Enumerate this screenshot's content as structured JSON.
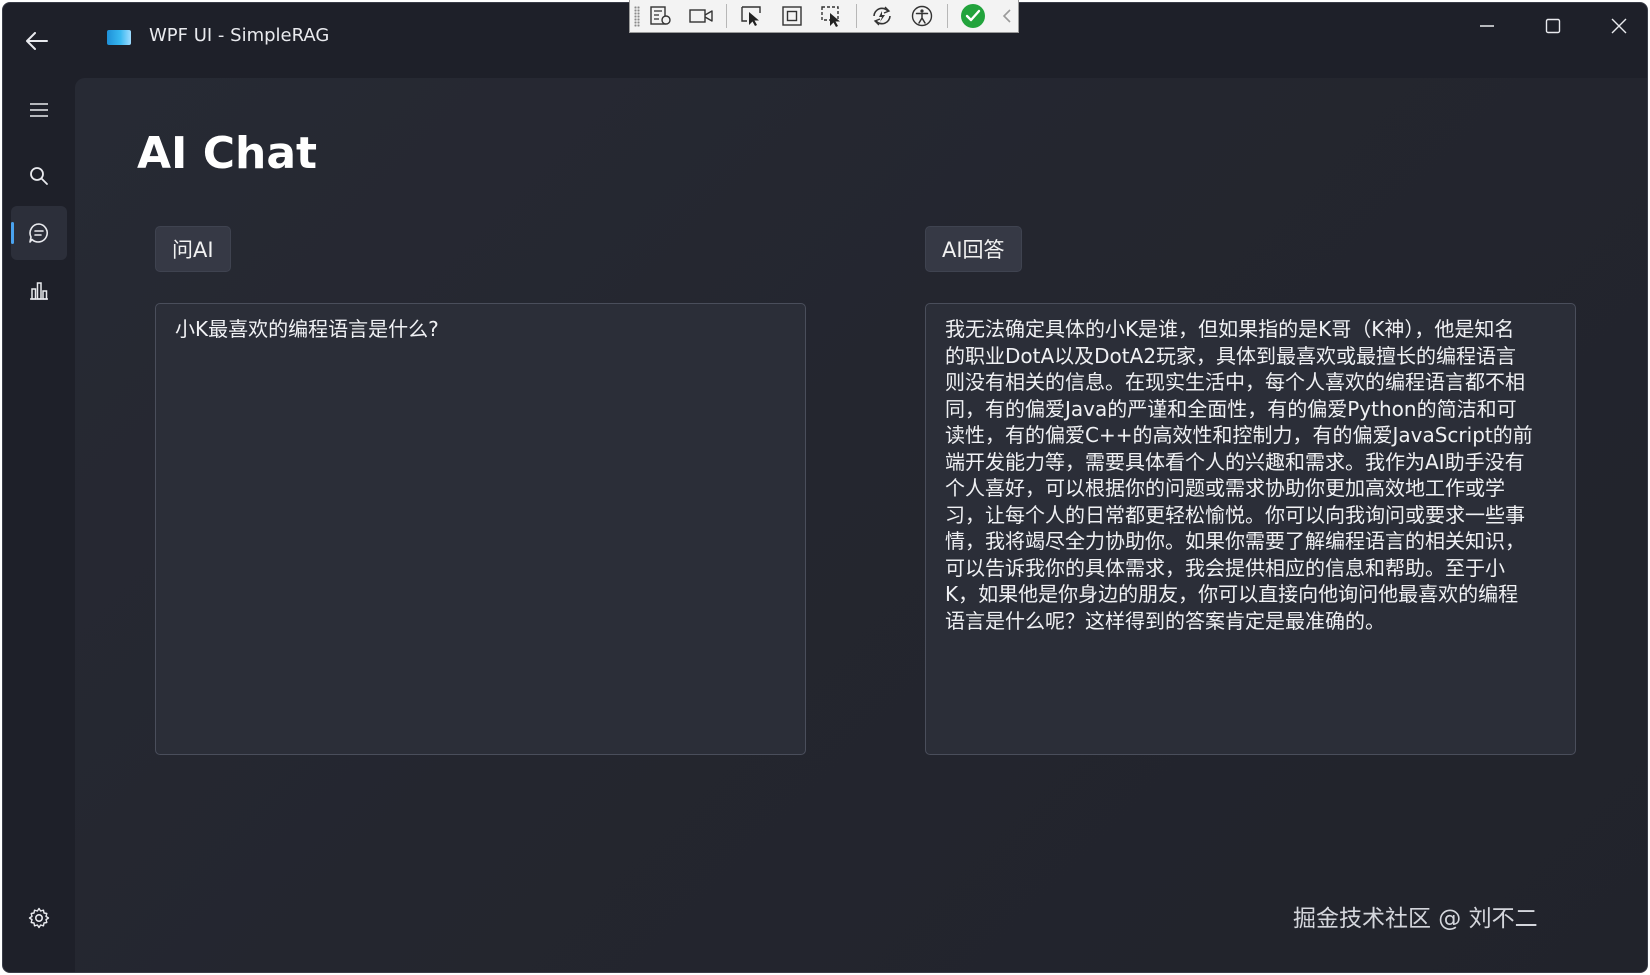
{
  "window": {
    "title": "WPF UI - SimpleRAG",
    "icons": {
      "back": "arrow-left-icon",
      "minimize": "minimize-icon",
      "maximize": "maximize-icon",
      "close": "close-icon"
    }
  },
  "debug_toolbar": {
    "icons": [
      "live-visual-tree-icon",
      "video-camera-icon",
      "select-element-icon",
      "display-layout-adorners-icon",
      "track-focus-icon",
      "hot-reload-icon",
      "accessibility-icon",
      "status-ok-icon",
      "collapse-chevron-icon"
    ],
    "status_color": "#22a33c"
  },
  "nav": {
    "items": [
      {
        "icon": "hamburger-menu-icon",
        "active": false
      },
      {
        "icon": "search-icon",
        "active": false
      },
      {
        "icon": "chat-icon",
        "active": true
      },
      {
        "icon": "bar-chart-icon",
        "active": false
      }
    ],
    "footer_icon": "gear-icon",
    "accent_color": "#4aa3ef"
  },
  "page": {
    "title": "AI Chat",
    "ask_label": "问AI",
    "answer_label": "AI回答",
    "question_text": "小K最喜欢的编程语言是什么?",
    "answer_lines": [
      "我无法确定具体的小K是谁，但如果指的是K哥（K神），他是知名",
      "的职业DotA以及DotA2玩家，具体到最喜欢或最擅长的编程语言",
      "则没有相关的信息。在现实生活中，每个人喜欢的编程语言都不相",
      "同，有的偏爱Java的严谨和全面性，有的偏爱Python的简洁和可",
      "读性，有的偏爱C++的高效性和控制力，有的偏爱JavaScript的前",
      "端开发能力等，需要具体看个人的兴趣和需求。我作为AI助手没有",
      "个人喜好，可以根据你的问题或需求协助你更加高效地工作或学",
      "习，让每个人的日常都更轻松愉悦。你可以向我询问或要求一些事",
      "情，我将竭尽全力协助你。如果你需要了解编程语言的相关知识，",
      "可以告诉我你的具体需求，我会提供相应的信息和帮助。至于小",
      "K，如果他是你身边的朋友，你可以直接向他询问他最喜欢的编程",
      "语言是什么呢？这样得到的答案肯定是最准确的。"
    ]
  },
  "watermark": "掘金技术社区 @ 刘不二"
}
